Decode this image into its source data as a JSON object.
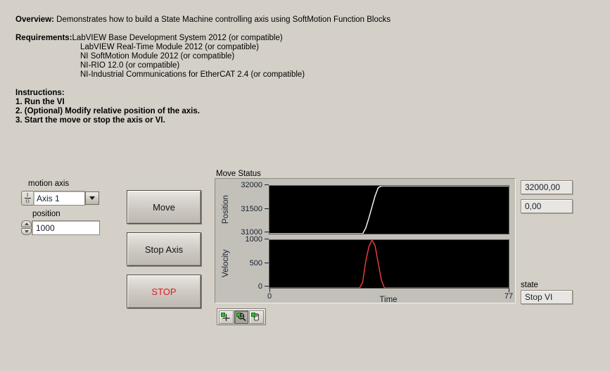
{
  "document": {
    "overview_label": "Overview:",
    "overview_text": " Demonstrates how to build a State Machine controlling axis using SoftMotion Function Blocks",
    "requirements_label": "Requirements:",
    "requirements": [
      "LabVIEW Base Development System 2012 (or compatible)",
      "LabVIEW Real-Time Module 2012 (or compatible)",
      "NI SoftMotion Module 2012 (or compatible)",
      "NI-RIO 12.0 (or compatible)",
      "NI-Industrial Communications for EtherCAT 2.4 (or compatible)"
    ],
    "instructions_label": "Instructions:",
    "instructions": [
      "1. Run the VI",
      "2. (Optional) Modify relative position of the axis.",
      "3. Start the move or stop the axis or VI."
    ]
  },
  "controls": {
    "motion_axis": {
      "label": "motion axis",
      "value": "Axis 1",
      "glyph_top": "I",
      "glyph_bottom": "O",
      "arrow_icon": "chevron-down-icon"
    },
    "position": {
      "label": "position",
      "value": "1000"
    },
    "buttons": {
      "move": "Move",
      "stop_axis": "Stop Axis",
      "stop_vi": "STOP",
      "stop_vi_color": "#e01b1b"
    }
  },
  "graph": {
    "title": "Move Status",
    "palette": {
      "cursor_tool": "crosshair-cursor-icon",
      "zoom_tool": "zoom-magnifier-icon",
      "pan_tool": "pan-hand-icon",
      "active_tool": "zoom-magnifier-icon"
    }
  },
  "indicators": {
    "position_value": "32000,00",
    "velocity_value": "0,00",
    "state_label": "state",
    "state_value": "Stop VI"
  },
  "chart_data": {
    "type": "line",
    "title": "Move Status",
    "xlabel": "Time",
    "x_ticks": [
      "0",
      "77"
    ],
    "xlim": [
      0,
      77
    ],
    "grid": false,
    "legend": "none",
    "background": "#000000",
    "panels": [
      {
        "ylabel": "Position",
        "y_ticks": [
          "31000",
          "31500",
          "32000"
        ],
        "ylim": [
          31000,
          32000
        ],
        "series": [
          {
            "name": "Position",
            "color": "#ffffff",
            "x": [
              0,
              30,
              31,
              32,
              33,
              34,
              35,
              36,
              77
            ],
            "values": [
              31000,
              31000,
              31120,
              31330,
              31560,
              31790,
              31960,
              32000,
              32000
            ]
          }
        ]
      },
      {
        "ylabel": "Velocity",
        "y_ticks": [
          "0",
          "500",
          "1000"
        ],
        "ylim": [
          0,
          1000
        ],
        "series": [
          {
            "name": "Velocity",
            "color": "#f0403c",
            "x": [
              0,
              29,
              30,
              31,
              32,
              33,
              34,
              35,
              36,
              37,
              77
            ],
            "values": [
              0,
              0,
              120,
              560,
              860,
              1000,
              880,
              520,
              170,
              0,
              0
            ]
          }
        ]
      }
    ]
  }
}
